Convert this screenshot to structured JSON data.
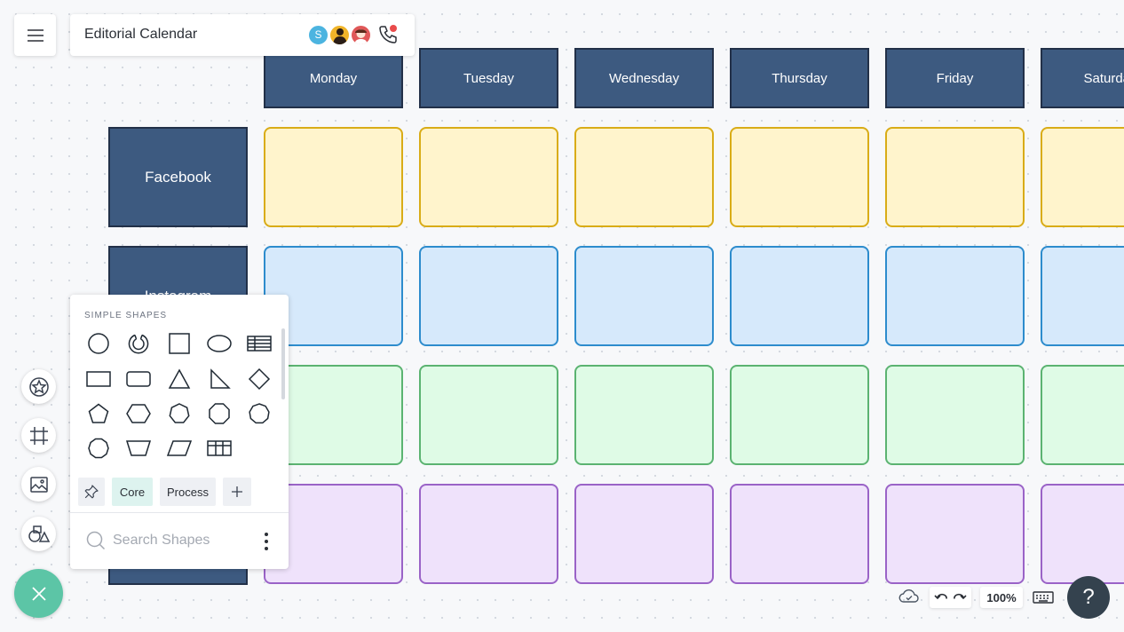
{
  "header": {
    "title": "Editorial Calendar",
    "avatars": [
      {
        "initial": "S",
        "color": "#4cb4e0"
      },
      {
        "initial": "",
        "color": "#f0b429"
      },
      {
        "initial": "",
        "color": "#e05858"
      }
    ]
  },
  "calendar": {
    "days": [
      "Monday",
      "Tuesday",
      "Wednesday",
      "Thursday",
      "Friday",
      "Saturday"
    ],
    "rows": [
      "Facebook",
      "Instagram",
      "",
      ""
    ],
    "row_colors": [
      "yellow",
      "blue",
      "green",
      "purple"
    ]
  },
  "shapes_panel": {
    "heading": "SIMPLE SHAPES",
    "shapes": [
      "circle",
      "arc",
      "square",
      "ellipse",
      "table",
      "rectangle",
      "rounded-rectangle",
      "triangle",
      "right-triangle",
      "diamond",
      "pentagon",
      "hexagon",
      "heptagon",
      "octagon",
      "nonagon",
      "decagon",
      "trapezoid",
      "parallelogram",
      "grid"
    ],
    "tabs": {
      "core": "Core",
      "process": "Process"
    },
    "search_placeholder": "Search Shapes"
  },
  "toolbar": {
    "zoom": "100%",
    "help": "?"
  },
  "colors": {
    "header_fill": "#3d5a80",
    "fab": "#5cc5a6",
    "help": "#34424e"
  }
}
